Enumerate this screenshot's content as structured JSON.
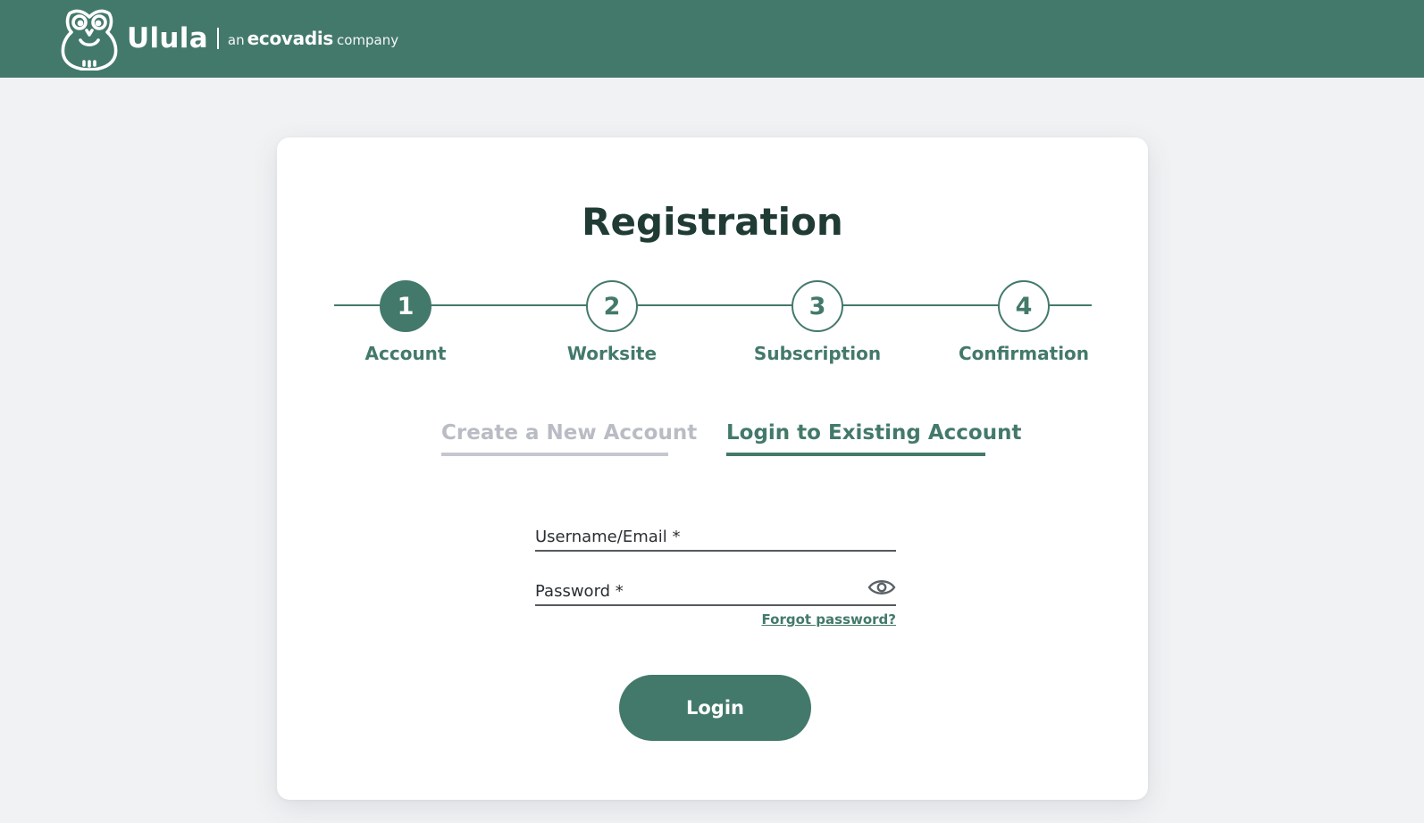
{
  "header": {
    "brand_name": "Ulula",
    "tagline_prefix": "an",
    "tagline_company": "ecovadis",
    "tagline_suffix": "company",
    "logo_icon": "owl-icon",
    "background_color": "#43796b"
  },
  "registration": {
    "title": "Registration",
    "steps": [
      {
        "number": "1",
        "label": "Account",
        "active": true
      },
      {
        "number": "2",
        "label": "Worksite",
        "active": false
      },
      {
        "number": "3",
        "label": "Subscription",
        "active": false
      },
      {
        "number": "4",
        "label": "Confirmation",
        "active": false
      }
    ],
    "tabs": {
      "create": "Create a New Account",
      "login": "Login to Existing Account",
      "selected": "login"
    },
    "form": {
      "username_placeholder": "Username/Email *",
      "username_value": "",
      "password_placeholder": "Password *",
      "password_value": "",
      "password_toggle_icon": "eye-icon",
      "forgot_password": "Forgot password?",
      "login_button": "Login"
    }
  },
  "colors": {
    "accent": "#43796b",
    "page_background": "#f1f2f4",
    "inactive_tab": "#b9bcc4",
    "title": "#1f3b34"
  }
}
